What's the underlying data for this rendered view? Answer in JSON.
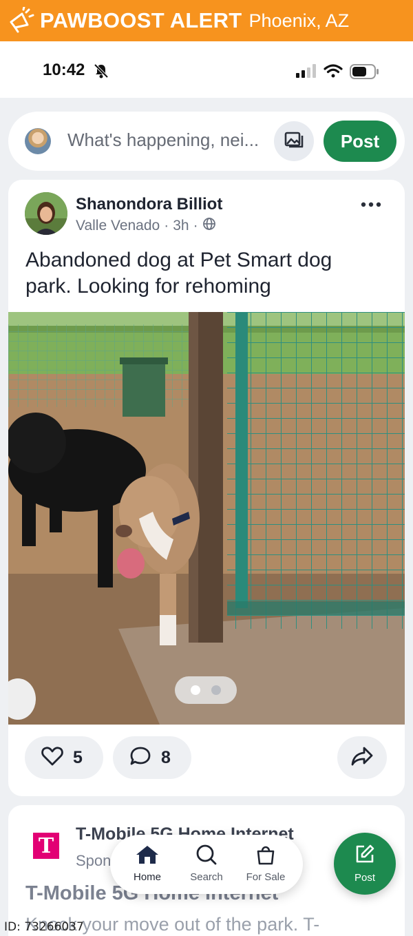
{
  "alert": {
    "title": "PAWBOOST ALERT",
    "location": "Phoenix, AZ",
    "icon": "megaphone-icon",
    "color": "#f7931e"
  },
  "status": {
    "time": "10:42",
    "icons": [
      "bell-slash-icon",
      "signal-icon",
      "wifi-icon",
      "battery-icon"
    ]
  },
  "composer": {
    "placeholder": "What's happening, nei...",
    "post_label": "Post",
    "photo_icon": "photo-icon"
  },
  "post": {
    "author": "Shanondora Billiot",
    "neighborhood": "Valle Venado",
    "age": "3h",
    "visibility_icon": "globe-icon",
    "text": "Abandoned dog at Pet Smart dog park. Looking for rehoming",
    "carousel": {
      "count": 2,
      "active": 0
    },
    "likes": "5",
    "comments": "8"
  },
  "ad": {
    "name": "T-Mobile 5G Home Internet",
    "sponsor": "Sponsored",
    "headline": "T-Mobile 5G Home Internet",
    "body": "Knock your move out of the park. T-"
  },
  "nav": {
    "items": [
      {
        "label": "Home",
        "icon": "home-icon",
        "active": true
      },
      {
        "label": "Search",
        "icon": "search-icon",
        "active": false
      },
      {
        "label": "For Sale",
        "icon": "shopping-bag-icon",
        "active": false
      }
    ],
    "fab_label": "Post"
  },
  "watermark": "ID: 73266037",
  "colors": {
    "accent": "#1d8a4f",
    "alert": "#f7931e",
    "tmobile": "#e20074"
  }
}
